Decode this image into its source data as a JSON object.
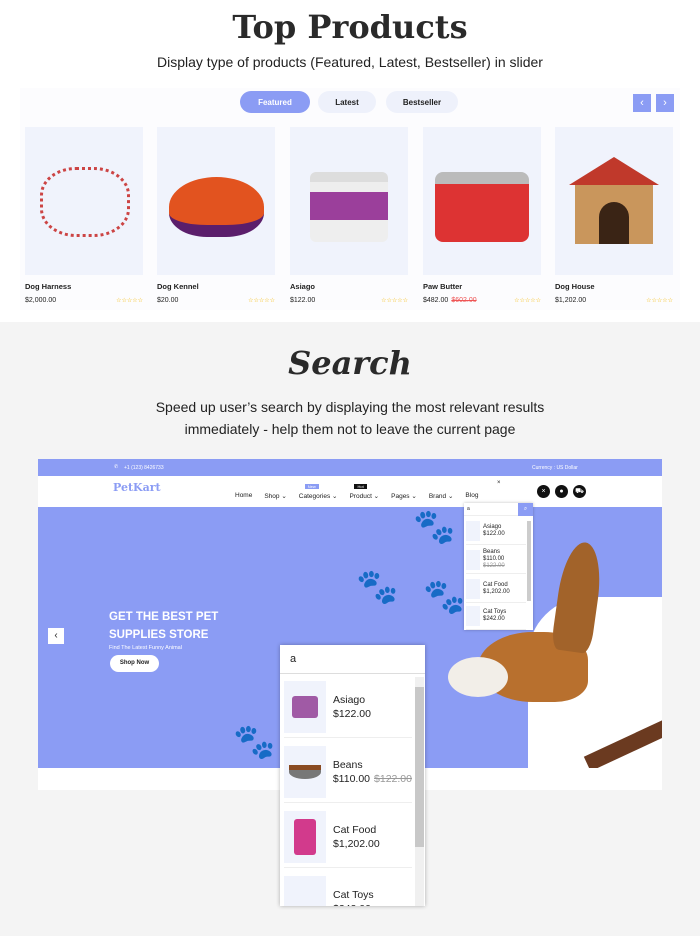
{
  "top_products": {
    "title": "Top Products",
    "subtitle": "Display type of products (Featured, Latest, Bestseller) in slider",
    "tabs": [
      {
        "label": "Featured",
        "active": true
      },
      {
        "label": "Latest",
        "active": false
      },
      {
        "label": "Bestseller",
        "active": false
      }
    ],
    "prev": "‹",
    "next": "›",
    "products": [
      {
        "name": "Dog Harness",
        "price": "$2,000.00",
        "old_price": "",
        "rating": "☆☆☆☆☆"
      },
      {
        "name": "Dog Kennel",
        "price": "$20.00",
        "old_price": "",
        "rating": "☆☆☆☆☆"
      },
      {
        "name": "Asiago",
        "price": "$122.00",
        "old_price": "",
        "rating": "☆☆☆☆☆"
      },
      {
        "name": "Paw Butter",
        "price": "$482.00",
        "old_price": "$602.00",
        "rating": "☆☆☆☆☆"
      },
      {
        "name": "Dog House",
        "price": "$1,202.00",
        "old_price": "",
        "rating": "☆☆☆☆☆"
      }
    ]
  },
  "search": {
    "title": "Search",
    "subtitle_1": "Speed up user’s search by displaying the most relevant results",
    "subtitle_2": "immediately - help them not to leave the current page"
  },
  "demo": {
    "phone": "+1 (123) 8426733",
    "currency": "Currency : US Dollar",
    "logo": "PetKart",
    "nav": [
      {
        "label": "Home"
      },
      {
        "label": "Shop ⌄"
      },
      {
        "label": "Categories ⌄",
        "badge": "New"
      },
      {
        "label": "Product ⌄",
        "badge": "Hot"
      },
      {
        "label": "Pages ⌄"
      },
      {
        "label": "Brand ⌄"
      },
      {
        "label": "Blog"
      }
    ],
    "hero_title_1": "GET THE BEST PET",
    "hero_title_2": "SUPPLIES STORE",
    "hero_sub": "Find The Latest Funny Animal",
    "shop_now": "Shop Now",
    "search_query": "a",
    "results": [
      {
        "name": "Asiago",
        "price": "$122.00",
        "old_price": ""
      },
      {
        "name": "Beans",
        "price": "$110.00",
        "old_price": "$122.00"
      },
      {
        "name": "Cat Food",
        "price": "$1,202.00",
        "old_price": ""
      },
      {
        "name": "Cat Toys",
        "price": "$242.00",
        "old_price": ""
      }
    ],
    "accent": "#8b9cf4"
  }
}
